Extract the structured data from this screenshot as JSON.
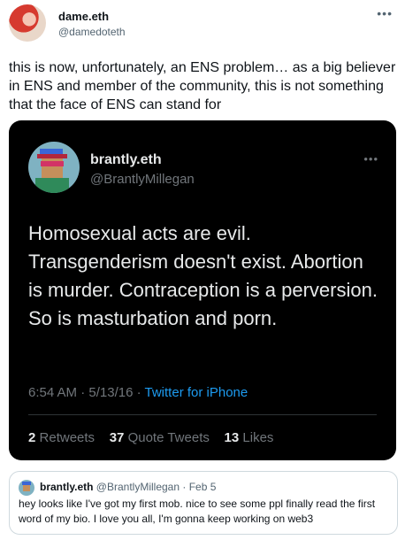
{
  "tweet": {
    "display_name": "dame.eth",
    "handle": "@damedoteth",
    "more_icon": "more-horizontal-icon",
    "text": "this is now, unfortunately, an ENS problem… as a big believer in ENS and member of the community, this is not something that the face of ENS can stand for"
  },
  "embedded_tweet": {
    "display_name": "brantly.eth",
    "handle": "@BrantlyMillegan",
    "more_icon": "more-horizontal-icon",
    "text": "Homosexual acts are evil. Transgenderism doesn't exist. Abortion is murder. Contraception is a perversion. So is masturbation and porn.",
    "time": "6:54 AM",
    "date": "5/13/16",
    "source": "Twitter for iPhone",
    "separator": "·",
    "retweets_count": "2",
    "retweets_label": "Retweets",
    "quote_count": "37",
    "quote_label": "Quote Tweets",
    "likes_count": "13",
    "likes_label": "Likes",
    "background": "#000000",
    "link_color": "#1d9bf0"
  },
  "quoted_tweet": {
    "display_name": "brantly.eth",
    "handle": "@BrantlyMillegan",
    "separator": "·",
    "date": "Feb 5",
    "text": "hey looks like I've got my first mob. nice to see some ppl finally read the first word of my bio. I love you all, I'm gonna keep working on web3"
  }
}
